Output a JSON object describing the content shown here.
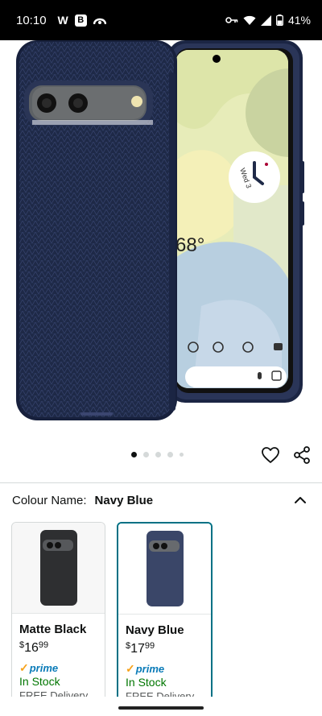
{
  "status_bar": {
    "time": "10:10",
    "app_w": "W",
    "app_b": "B",
    "battery": "41%",
    "icons": [
      "key-icon",
      "wifi-icon",
      "signal-icon",
      "battery-icon"
    ]
  },
  "product": {
    "image_alt": "Navy blue textured phone case on Pixel 7",
    "dots_total": 5,
    "dots_active": 1,
    "clock_date": "Wed 3"
  },
  "colour": {
    "label": "Colour Name:",
    "value": "Navy Blue"
  },
  "variants": [
    {
      "name": "Matte Black",
      "currency": "$",
      "price_whole": "16",
      "price_cents": "99",
      "prime": "prime",
      "stock": "In Stock",
      "delivery": "FREE Delivery",
      "selected": false
    },
    {
      "name": "Navy Blue",
      "currency": "$",
      "price_whole": "17",
      "price_cents": "99",
      "prime": "prime",
      "stock": "In Stock",
      "delivery": "FREE Delivery",
      "selected": true
    }
  ],
  "colors": {
    "accent_teal": "#007185",
    "stock_green": "#007600",
    "prime_blue": "#0a7bb8",
    "prime_orange": "#f7a21b",
    "case_navy": "#1f2a48"
  },
  "phone_screen": {
    "temperature": "68°"
  }
}
